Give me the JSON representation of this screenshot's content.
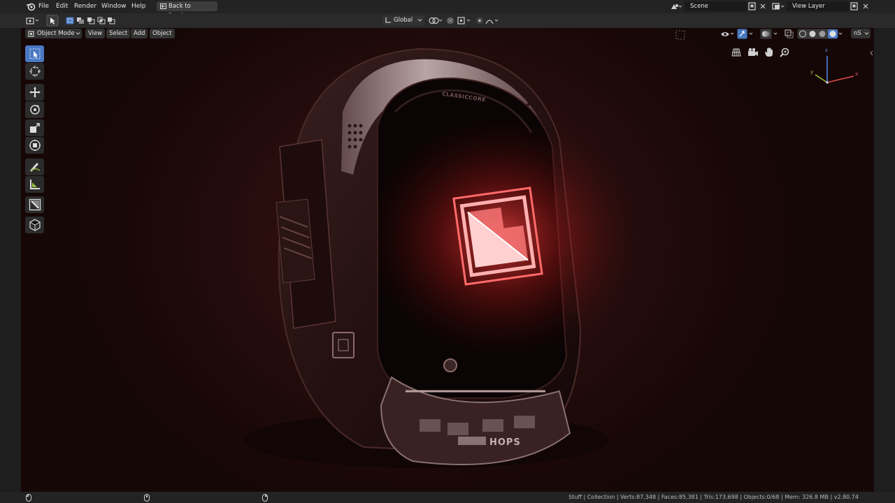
{
  "topbar": {
    "menus": [
      "File",
      "Edit",
      "Render",
      "Window",
      "Help"
    ],
    "back_button": "Back to Previous",
    "scene_name": "Scene",
    "view_layer_name": "View Layer"
  },
  "header": {
    "orientation": "Global"
  },
  "viewport_header": {
    "mode": "Object Mode",
    "menus": [
      "View",
      "Select",
      "Add",
      "Object"
    ],
    "overlay_label": "nS"
  },
  "toolbar": {
    "tools": [
      {
        "name": "select-tool",
        "icon": "cursor-select-icon",
        "active": true
      },
      {
        "name": "cursor-tool",
        "icon": "3d-cursor-icon",
        "active": false
      },
      {
        "name": "move-tool",
        "icon": "move-icon",
        "active": false
      },
      {
        "name": "rotate-tool",
        "icon": "rotate-icon",
        "active": false
      },
      {
        "name": "scale-tool",
        "icon": "scale-icon",
        "active": false
      },
      {
        "name": "transform-tool",
        "icon": "transform-icon",
        "active": false
      },
      {
        "name": "annotate-tool",
        "icon": "annotate-icon",
        "active": false
      },
      {
        "name": "measure-tool",
        "icon": "measure-icon",
        "active": false
      },
      {
        "name": "box-cutter-tool",
        "icon": "box-cutter-icon",
        "active": false
      },
      {
        "name": "hops-tool",
        "icon": "hops-cube-icon",
        "active": false
      }
    ]
  },
  "model_text": {
    "brand": "CLASSICCORE",
    "hops": "HOPS"
  },
  "gizmo": {
    "x": "x",
    "y": "y",
    "z": "z"
  },
  "status": {
    "text": "Stuff | Collection | Verts:87,348 | Faces:85,381 | Tris:173,698 | Objects:0/68 | Mem: 326.8 MB | v2.80.74"
  },
  "colors": {
    "accent": "#4a78c2",
    "glow": "#ff3b3b",
    "viewport_bg": "#2a0e0e"
  }
}
